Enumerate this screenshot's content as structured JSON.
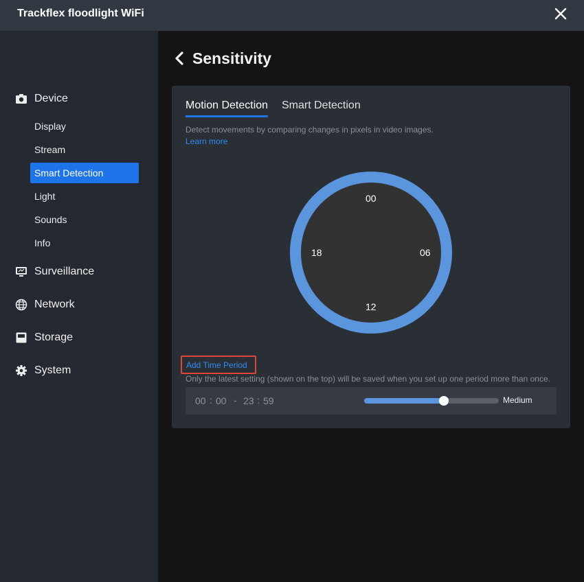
{
  "window": {
    "title": "Trackflex floodlight WiFi",
    "close_icon": "close-icon"
  },
  "sidebar": {
    "categories": [
      {
        "label": "Device",
        "icon": "camera-icon"
      },
      {
        "label": "Surveillance",
        "icon": "monitor-icon"
      },
      {
        "label": "Network",
        "icon": "globe-icon"
      },
      {
        "label": "Storage",
        "icon": "storage-icon"
      },
      {
        "label": "System",
        "icon": "gear-icon"
      }
    ],
    "device_items": [
      "Display",
      "Stream",
      "Smart Detection",
      "Light",
      "Sounds",
      "Info"
    ],
    "active_item": "Smart Detection"
  },
  "page": {
    "title": "Sensitivity",
    "back_icon": "chevron-left-icon"
  },
  "tabs": {
    "active": "Motion Detection",
    "items": [
      "Motion Detection",
      "Smart Detection"
    ]
  },
  "description": "Detect movements by comparing changes in pixels in video images.",
  "learn_more": "Learn more",
  "dial": {
    "top": "00",
    "right": "06",
    "bottom": "12",
    "left": "18"
  },
  "add_period": "Add Time Period",
  "note": "Only the latest setting (shown on the top) will be saved when you set up one period more than once.",
  "period": {
    "start_h": "00",
    "start_m": "00",
    "sep": ":",
    "dash": "-",
    "end_h": "23",
    "end_m": "59",
    "sensitivity_fraction": 0.59,
    "sensitivity_label": "Medium"
  },
  "colors": {
    "accent": "#1f73e8",
    "dial_ring": "#5b95de",
    "link": "#2f8cf0",
    "highlight_box": "#e0453a"
  }
}
